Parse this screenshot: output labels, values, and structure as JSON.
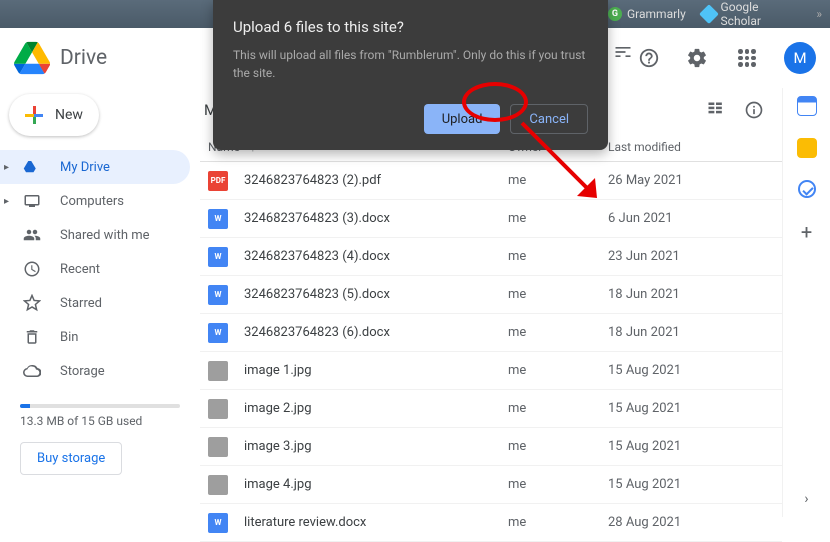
{
  "bookmarks": {
    "grammarly": "Grammarly",
    "scholar": "Google Scholar"
  },
  "header": {
    "brand": "Drive",
    "avatar_letter": "M"
  },
  "sidebar": {
    "new_label": "New",
    "items": [
      {
        "label": "My Drive"
      },
      {
        "label": "Computers"
      },
      {
        "label": "Shared with me"
      },
      {
        "label": "Recent"
      },
      {
        "label": "Starred"
      },
      {
        "label": "Bin"
      },
      {
        "label": "Storage"
      }
    ],
    "storage_text": "13.3 MB of 15 GB used",
    "buy_label": "Buy storage"
  },
  "content": {
    "title_partial": "M",
    "cols": {
      "name": "Name",
      "owner": "Owner",
      "modified": "Last modified"
    },
    "files": [
      {
        "name": "3246823764823 (2).pdf",
        "owner": "me",
        "modified": "26 May 2021",
        "type": "pdf"
      },
      {
        "name": "3246823764823 (3).docx",
        "owner": "me",
        "modified": "6 Jun 2021",
        "type": "docx"
      },
      {
        "name": "3246823764823 (4).docx",
        "owner": "me",
        "modified": "23 Jun 2021",
        "type": "docx"
      },
      {
        "name": "3246823764823 (5).docx",
        "owner": "me",
        "modified": "18 Jun 2021",
        "type": "docx"
      },
      {
        "name": "3246823764823 (6).docx",
        "owner": "me",
        "modified": "18 Jun 2021",
        "type": "docx"
      },
      {
        "name": "image 1.jpg",
        "owner": "me",
        "modified": "15 Aug 2021",
        "type": "img"
      },
      {
        "name": "image 2.jpg",
        "owner": "me",
        "modified": "15 Aug 2021",
        "type": "img"
      },
      {
        "name": "image 3.jpg",
        "owner": "me",
        "modified": "15 Aug 2021",
        "type": "img"
      },
      {
        "name": "image 4.jpg",
        "owner": "me",
        "modified": "15 Aug 2021",
        "type": "img"
      },
      {
        "name": "literature review.docx",
        "owner": "me",
        "modified": "28 Aug 2021",
        "type": "docx"
      }
    ]
  },
  "dialog": {
    "title": "Upload 6 files to this site?",
    "message": "This will upload all files from \"Rumblerum\". Only do this if you trust the site.",
    "upload_label": "Upload",
    "cancel_label": "Cancel"
  }
}
